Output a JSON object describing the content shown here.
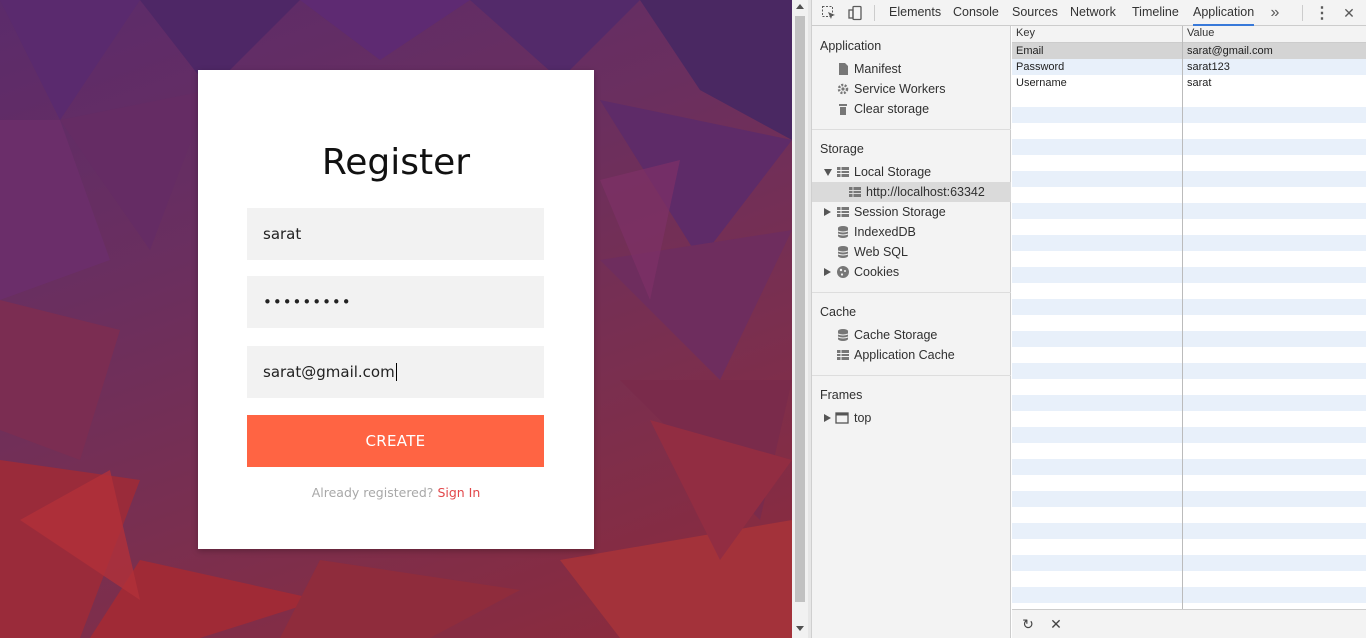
{
  "page": {
    "form": {
      "title": "Register",
      "username_value": "sarat",
      "password_value": "•••••••••",
      "email_value": "sarat@gmail.com",
      "create_label": "CREATE",
      "already_text": "Already registered?",
      "signin_label": "Sign In"
    },
    "colors": {
      "accent": "#ff6443",
      "link": "#e2474a",
      "devtools_active_tab": "#3879d9"
    }
  },
  "devtools": {
    "toolbar": {
      "icons": [
        "inspect-icon",
        "device-toolbar-icon"
      ],
      "tabs": [
        "Elements",
        "Console",
        "Sources",
        "Network",
        "Timeline",
        "Application"
      ],
      "active_tab": "Application",
      "overflow_glyph": "»",
      "menu_glyph": "⋮",
      "close_glyph": "✕"
    },
    "sidebar": {
      "application": {
        "title": "Application",
        "items": [
          "Manifest",
          "Service Workers",
          "Clear storage"
        ]
      },
      "storage": {
        "title": "Storage",
        "local_storage": "Local Storage",
        "local_storage_origin": "http://localhost:63342",
        "session_storage": "Session Storage",
        "indexeddb": "IndexedDB",
        "websql": "Web SQL",
        "cookies": "Cookies"
      },
      "cache": {
        "title": "Cache",
        "items": [
          "Cache Storage",
          "Application Cache"
        ]
      },
      "frames": {
        "title": "Frames",
        "top": "top"
      }
    },
    "table": {
      "headers": [
        "Key",
        "Value"
      ],
      "rows": [
        {
          "key": "Email",
          "value": "sarat@gmail.com"
        },
        {
          "key": "Password",
          "value": "sarat123"
        },
        {
          "key": "Username",
          "value": "sarat"
        }
      ]
    },
    "bottom_bar": {
      "refresh_glyph": "↻",
      "delete_glyph": "✕"
    }
  }
}
